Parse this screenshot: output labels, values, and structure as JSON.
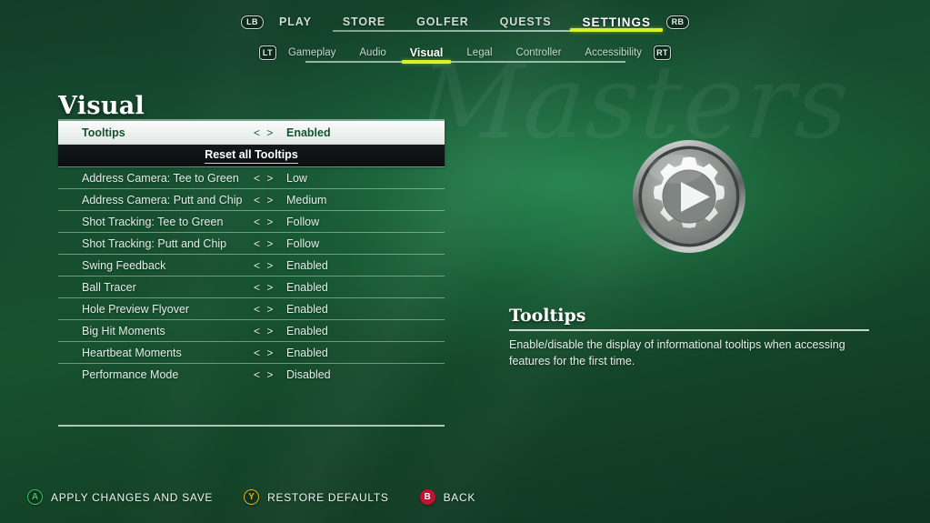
{
  "background": {
    "watermark_text": "Masters",
    "watermark_text_2": "",
    "base_color": "#14402a",
    "glow_color": "#2d945a"
  },
  "top_nav": {
    "left_bumper": "LB",
    "right_bumper": "RB",
    "active_index": 4,
    "accent_color": "#d7f22a",
    "items": [
      {
        "label": "PLAY"
      },
      {
        "label": "STORE"
      },
      {
        "label": "GOLFER"
      },
      {
        "label": "QUESTS"
      },
      {
        "label": "SETTINGS"
      }
    ]
  },
  "sub_nav": {
    "left_trigger": "LT",
    "right_trigger": "RT",
    "active_index": 2,
    "accent_color": "#d7f22a",
    "items": [
      {
        "label": "Gameplay"
      },
      {
        "label": "Audio"
      },
      {
        "label": "Visual"
      },
      {
        "label": "Legal"
      },
      {
        "label": "Controller"
      },
      {
        "label": "Accessibility"
      }
    ]
  },
  "page": {
    "title": "Visual"
  },
  "settings_list": {
    "rows": [
      {
        "type": "option",
        "label": "Tooltips",
        "arrows": "< >",
        "value": "Enabled",
        "selected": true
      },
      {
        "type": "action",
        "label": "Reset all Tooltips"
      },
      {
        "type": "option",
        "label": "Address Camera: Tee to Green",
        "arrows": "< >",
        "value": "Low",
        "selected": false
      },
      {
        "type": "option",
        "label": "Address Camera: Putt and Chip",
        "arrows": "< >",
        "value": "Medium",
        "selected": false
      },
      {
        "type": "option",
        "label": "Shot Tracking: Tee to Green",
        "arrows": "< >",
        "value": "Follow",
        "selected": false
      },
      {
        "type": "option",
        "label": "Shot Tracking: Putt and Chip",
        "arrows": "< >",
        "value": "Follow",
        "selected": false
      },
      {
        "type": "option",
        "label": "Swing Feedback",
        "arrows": "< >",
        "value": "Enabled",
        "selected": false
      },
      {
        "type": "option",
        "label": "Ball Tracer",
        "arrows": "< >",
        "value": "Enabled",
        "selected": false
      },
      {
        "type": "option",
        "label": "Hole Preview Flyover",
        "arrows": "< >",
        "value": "Enabled",
        "selected": false
      },
      {
        "type": "option",
        "label": "Big Hit Moments",
        "arrows": "< >",
        "value": "Enabled",
        "selected": false
      },
      {
        "type": "option",
        "label": "Heartbeat Moments",
        "arrows": "< >",
        "value": "Enabled",
        "selected": false
      },
      {
        "type": "option",
        "label": "Performance Mode",
        "arrows": "< >",
        "value": "Disabled",
        "selected": false
      }
    ]
  },
  "info_panel": {
    "icon": "gear-play-medallion",
    "title": "Tooltips",
    "description": "Enable/disable the display of informational tooltips when accessing features for the first time."
  },
  "footer": {
    "actions": [
      {
        "button": "A",
        "label": "APPLY CHANGES AND SAVE",
        "color": "#3fbf63"
      },
      {
        "button": "Y",
        "label": "RESTORE DEFAULTS",
        "color": "#e0b321"
      },
      {
        "button": "B",
        "label": "BACK",
        "color": "#c21334"
      }
    ]
  }
}
